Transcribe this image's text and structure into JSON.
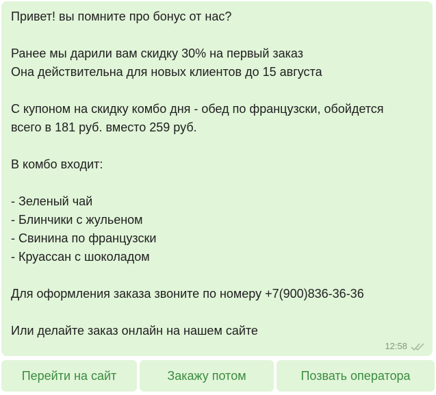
{
  "message": {
    "lines": [
      "Привет! вы помните про бонус от нас?",
      "",
      "Ранее мы дарили вам скидку 30% на первый заказ",
      "Она действительна для новых клиентов до 15 августа",
      "",
      "С купоном на скидку комбо дня - обед по французски, обойдется",
      "всего в 181 руб. вместо 259 руб.",
      "",
      "В комбо входит:",
      "",
      "- Зеленый чай",
      "- Блинчики с жульеном",
      "- Свинина по французски",
      "- Круассан с шоколадом",
      "",
      "Для оформления заказа звоните по номеру +7(900)836-36-36",
      "",
      "Или делайте заказ онлайн на нашем сайте"
    ],
    "time": "12:58",
    "status_icon": "double-check-icon",
    "bubble_color": "#e1f5d9"
  },
  "buttons": {
    "open_site_label": "Перейти на сайт",
    "order_later_label": "Закажу потом",
    "call_operator_label": "Позвать оператора",
    "text_color": "#3a8c3f"
  }
}
